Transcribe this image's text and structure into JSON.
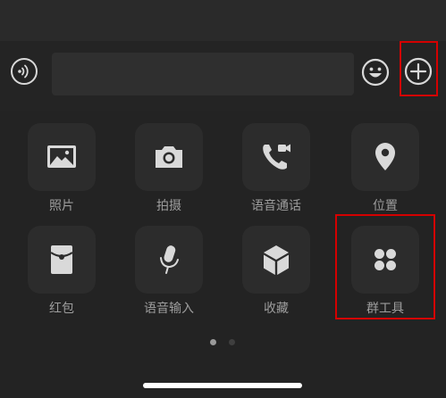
{
  "colors": {
    "background": "#232323",
    "tile": "#2c2c2c",
    "label": "#9d9d9d",
    "icon": "#d9d9d9",
    "highlight": "#d40000"
  },
  "input_bar": {
    "voice_icon": "voice-wave-icon",
    "input_value": "",
    "emoji_icon": "smiley-icon",
    "plus_icon": "plus-circle-icon"
  },
  "panel": {
    "items": [
      {
        "label": "照片",
        "icon": "photo-icon"
      },
      {
        "label": "拍摄",
        "icon": "camera-icon"
      },
      {
        "label": "语音通话",
        "icon": "voice-call-icon"
      },
      {
        "label": "位置",
        "icon": "location-pin-icon"
      },
      {
        "label": "红包",
        "icon": "red-envelope-icon"
      },
      {
        "label": "语音输入",
        "icon": "microphone-icon"
      },
      {
        "label": "收藏",
        "icon": "favorites-cube-icon"
      },
      {
        "label": "群工具",
        "icon": "group-tools-icon"
      }
    ]
  },
  "pager": {
    "page_count": 2,
    "current_page": 1
  }
}
